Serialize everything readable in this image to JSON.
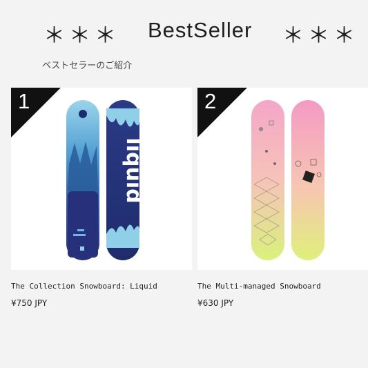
{
  "heading": {
    "stars_left": "＊＊＊",
    "title": "BestSeller",
    "stars_right": "＊＊＊"
  },
  "subtitle": "ベストセラーのご紹介",
  "products": [
    {
      "rank": "1",
      "name": "The Collection Snowboard: Liquid",
      "price": "¥750 JPY",
      "board_label": "liquid",
      "colors": {
        "deep": "#2a3a86",
        "mid": "#4a8fc4",
        "light": "#8fd0e8"
      }
    },
    {
      "rank": "2",
      "name": "The Multi-managed Snowboard",
      "price": "¥630 JPY",
      "colors": {
        "pink": "#f3a8c8",
        "peach": "#f7c9b0",
        "lime": "#d9f27a"
      }
    }
  ]
}
